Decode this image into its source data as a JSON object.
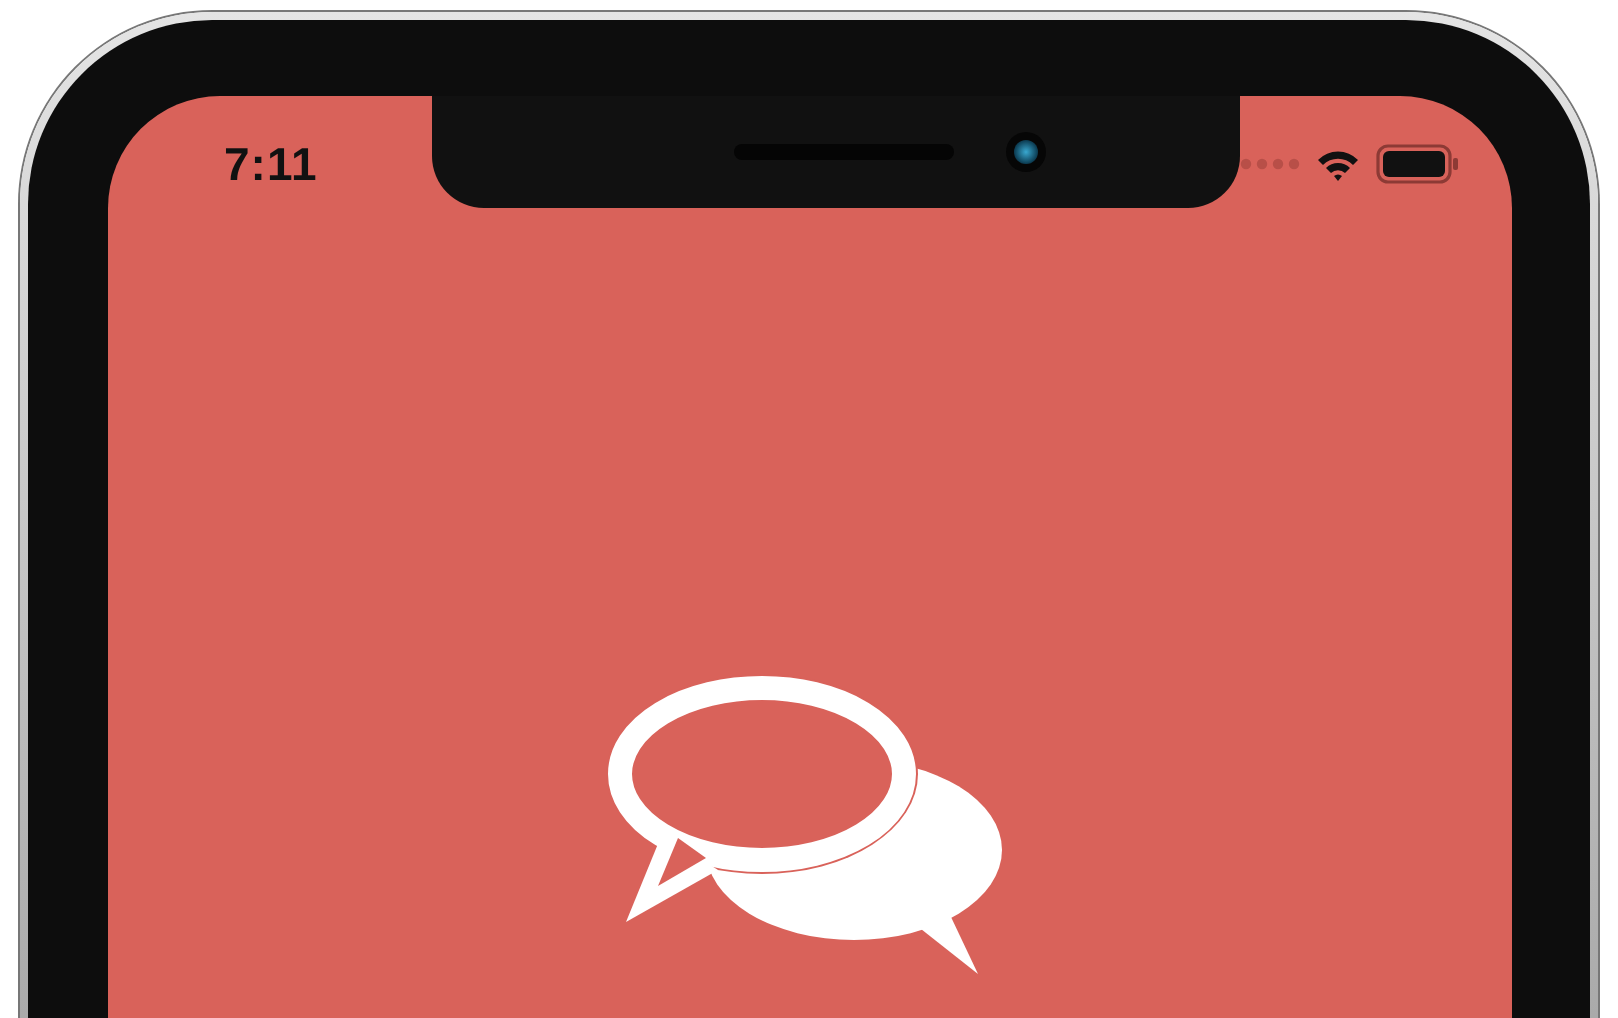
{
  "status_bar": {
    "time": "7:11"
  }
}
